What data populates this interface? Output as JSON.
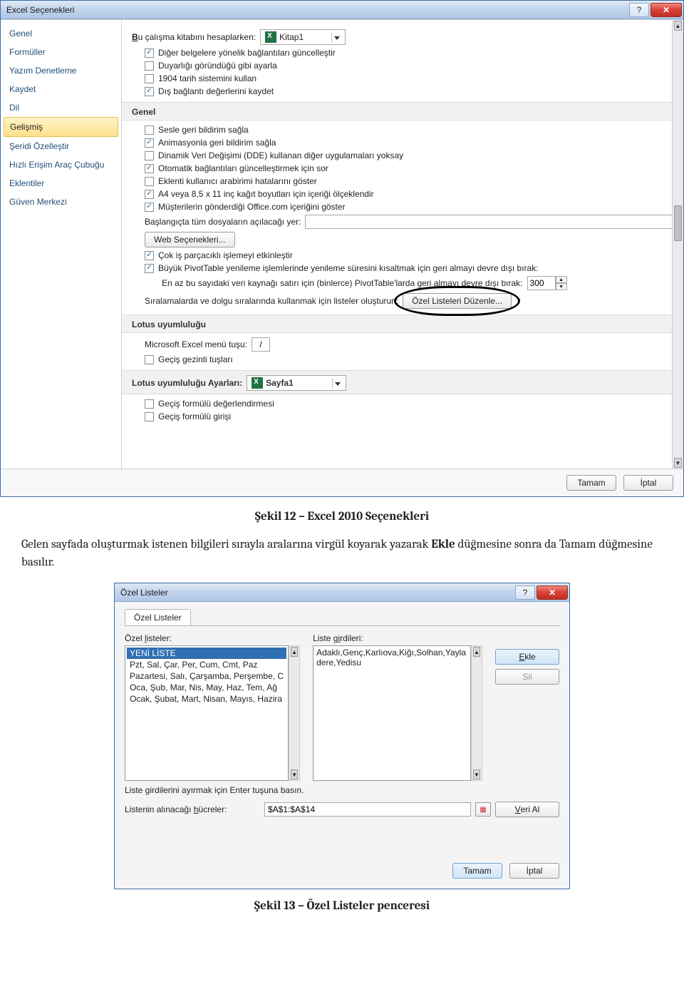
{
  "dialog1": {
    "title": "Excel Seçenekleri",
    "nav": [
      "Genel",
      "Formüller",
      "Yazım Denetleme",
      "Kaydet",
      "Dil",
      "Gelişmiş",
      "Şeridi Özelleştir",
      "Hızlı Erişim Araç Çubuğu",
      "Eklentiler",
      "Güven Merkezi"
    ],
    "nav_selected_index": 5,
    "calc_label": "Bu çalışma kitabını hesaplarken:",
    "calc_workbook": "Kitap1",
    "opts1": [
      {
        "checked": true,
        "text": "Diğer belgelere yönelik bağlantıları güncelleştir"
      },
      {
        "checked": false,
        "text": "Duyarlığı göründüğü gibi ayarla"
      },
      {
        "checked": false,
        "text": "1904 tarih sistemini kullan"
      },
      {
        "checked": true,
        "text": "Dış bağlantı değerlerini kaydet"
      }
    ],
    "section_general": "Genel",
    "opts2": [
      {
        "checked": false,
        "text": "Sesle geri bildirim sağla"
      },
      {
        "checked": true,
        "text": "Animasyonla geri bildirim sağla"
      },
      {
        "checked": false,
        "text": "Dinamik Veri Değişimi (DDE) kullanan diğer uygulamaları yoksay"
      },
      {
        "checked": true,
        "text": "Otomatik bağlantıları güncelleştirmek için sor"
      },
      {
        "checked": false,
        "text": "Eklenti kullanıcı arabirimi hatalarını göster"
      },
      {
        "checked": true,
        "text": "A4 veya 8,5 x 11 inç kağıt boyutları için içeriği ölçeklendir"
      },
      {
        "checked": true,
        "text": "Müşterilerin gönderdiği Office.com içeriğini göster"
      }
    ],
    "startup_label": "Başlangıçta tüm dosyaların açılacağı yer:",
    "web_options_btn": "Web Seçenekleri...",
    "opts3": [
      {
        "checked": true,
        "text": "Çok iş parçacıklı işlemeyi etkinleştir"
      },
      {
        "checked": true,
        "text": "Büyük PivotTable yenileme işlemlerinde yenileme süresini kısaltmak için geri almayı devre dışı bırak:"
      }
    ],
    "pivot_row_label": "En az bu sayıdaki veri kaynağı satırı için (binlerce) PivotTable'larda geri almayı devre dışı bırak:",
    "pivot_value": "300",
    "custom_list_label": "Sıralamalarda ve dolgu sıralarında kullanmak için listeler oluşturun:",
    "custom_list_btn": "Özel Listeleri Düzenle...",
    "section_lotus": "Lotus uyumluluğu",
    "menu_key_label": "Microsoft Excel menü tuşu:",
    "menu_key_value": "/",
    "transition_nav": {
      "checked": false,
      "text": "Geçiş gezinti tuşları"
    },
    "lotus_settings_label": "Lotus uyumluluğu Ayarları:",
    "lotus_sheet": "Sayfa1",
    "opts4": [
      {
        "checked": false,
        "text": "Geçiş formülü değerlendirmesi"
      },
      {
        "checked": false,
        "text": "Geçiş formülü girişi"
      }
    ],
    "ok": "Tamam",
    "cancel": "İptal"
  },
  "caption1": "Şekil 12 – Excel 2010 Seçenekleri",
  "paragraph": {
    "pre": "Gelen sayfada oluşturmak istenen bilgileri sırayla aralarına virgül koyarak yazarak ",
    "bold1": "Ekle",
    "mid": " düğmesine  sonra da Tamam düğmesine basılır."
  },
  "dialog2": {
    "title": "Özel Listeler",
    "tab": "Özel Listeler",
    "left_label": "Özel listeler:",
    "right_label": "Liste girdileri:",
    "list_items": [
      "YENİ LİSTE",
      "Pzt, Sal, Çar, Per, Cum, Cmt, Paz",
      "Pazartesi, Salı, Çarşamba, Perşembe, C",
      "Oca, Şub, Mar, Nis, May, Haz, Tem, Ağ",
      "Ocak, Şubat, Mart, Nisan, Mayıs, Hazira"
    ],
    "list_selected_index": 0,
    "entries_text": "Adaklı,Genç,Karlıova,Kiğı,Solhan,Yayla\ndere,Yedisu",
    "add_btn": "Ekle",
    "del_btn": "Sil",
    "hint": "Liste girdilerini ayırmak için Enter tuşuna basın.",
    "range_label": "Listenin alınacağı hücreler:",
    "range_value": "$A$1:$A$14",
    "import_btn": "Veri Al",
    "ok": "Tamam",
    "cancel": "İptal"
  },
  "caption2": "Şekil 13 – Özel Listeler penceresi"
}
